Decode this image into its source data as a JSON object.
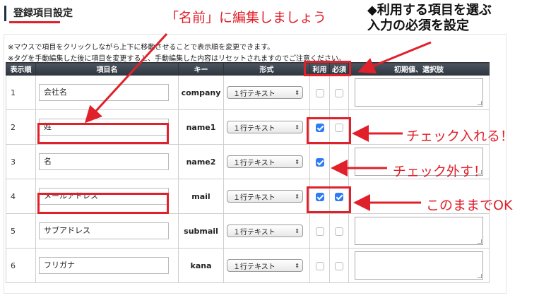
{
  "panel": {
    "title": "登録項目設定"
  },
  "annotations": {
    "name_edit": "「名前」に編集しましょう",
    "select_items_line1": "◆利用する項目を選ぶ",
    "select_items_line2": "入力の必須を設定",
    "check_in": "チェック入れる！",
    "check_out": "チェック外す！",
    "keep_ok": "このままでOK"
  },
  "notes": [
    "※マウスで項目をクリックしながら上下に移動させることで表示順を変更できます。",
    "※タグを手動編集した後に項目を変更すると、手動編集した内容はリセットされますのでご注意ください。"
  ],
  "table": {
    "headers": {
      "order": "表示順",
      "name": "項目名",
      "key": "キー",
      "type": "形式",
      "use": "利用",
      "required": "必須",
      "options": "初期値、選択肢"
    },
    "rows": [
      {
        "order": "1",
        "name": "会社名",
        "key": "company",
        "type": "１行テキスト",
        "use": false,
        "required": false,
        "show_options": true
      },
      {
        "order": "2",
        "name": "姓",
        "key": "name1",
        "type": "１行テキスト",
        "use": true,
        "required": false,
        "show_options": false
      },
      {
        "order": "3",
        "name": "名",
        "key": "name2",
        "type": "１行テキスト",
        "use": true,
        "required": false,
        "show_options": true
      },
      {
        "order": "4",
        "name": "メールアドレス",
        "key": "mail",
        "type": "１行テキスト",
        "use": true,
        "required": true,
        "show_options": false
      },
      {
        "order": "5",
        "name": "サブアドレス",
        "key": "submail",
        "type": "１行テキスト",
        "use": false,
        "required": false,
        "show_options": true
      },
      {
        "order": "6",
        "name": "フリガナ",
        "key": "kana",
        "type": "１行テキスト",
        "use": false,
        "required": false,
        "show_options": true
      }
    ]
  },
  "colors": {
    "annotation_red": "#e0202a",
    "checkbox_blue": "#2d7bf6",
    "header_dark": "#2e3640"
  },
  "icons": {
    "select_arrow": "up-down-arrows-icon",
    "textarea_resize": "resize-grip-icon"
  }
}
